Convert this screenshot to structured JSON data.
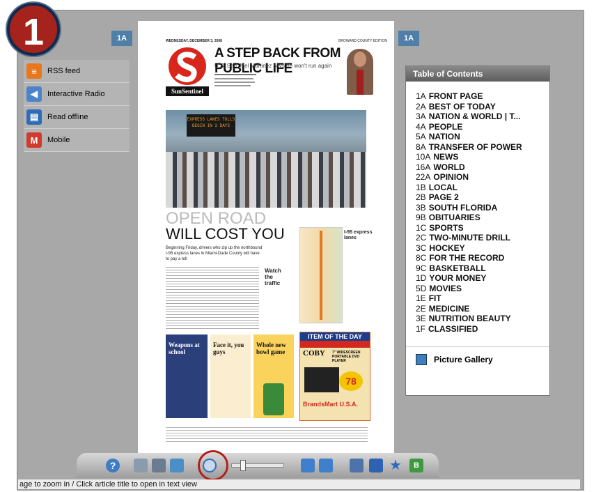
{
  "step_badge": "1",
  "page_tags": {
    "left": "1A",
    "right": "1A"
  },
  "left_panel": {
    "items": [
      {
        "label": "RSS feed",
        "icon": "rss-icon",
        "color": "#e8781a"
      },
      {
        "label": "Interactive Radio",
        "icon": "speaker-icon",
        "color": "#4b84c9"
      },
      {
        "label": "Read offline",
        "icon": "save-disk-icon",
        "color": "#2f6cb8"
      },
      {
        "label": "Mobile",
        "icon": "gmail-icon",
        "color": "#d23b2c"
      }
    ]
  },
  "newspaper": {
    "dateline": "WEDNESDAY, DECEMBER 3, 2008",
    "edition": "BROWARD COUNTY EDITION",
    "brand": "SunSentinel",
    "headline": "A STEP BACK FROM PUBLIC LIFE",
    "subhead": "U.S. Sen. Mel Martinez says he won't run again",
    "road_sign": "EXPRESS LANES TOLLS BEGIN IN 3 DAYS",
    "main_head_1": "OPEN ROAD",
    "main_head_2": "WILL COST YOU",
    "deck": "Beginning Friday, drivers who zip up the northbound I-95 express lanes in Miami-Dade County will have to pay a toll",
    "sidebar_head": "Watch the traffic",
    "map_head": "I-95 express lanes",
    "promo_1_head": "Weapons at school",
    "promo_2_head": "Face it, you guys",
    "promo_3_head": "Whole new bowl game",
    "ad_head": "ITEM OF THE DAY",
    "ad_brand": "COBY",
    "ad_desc": "7\" WIDESCREEN PORTABLE DVD PLAYER",
    "ad_price": "78",
    "ad_store": "BrandsMart U.S.A."
  },
  "toc": {
    "title": "Table of Contents",
    "items": [
      {
        "page": "1A",
        "label": "FRONT PAGE"
      },
      {
        "page": "2A",
        "label": "BEST OF TODAY"
      },
      {
        "page": "3A",
        "label": "NATION & WORLD | T..."
      },
      {
        "page": "4A",
        "label": "PEOPLE"
      },
      {
        "page": "5A",
        "label": "NATION"
      },
      {
        "page": "8A",
        "label": "TRANSFER OF POWER"
      },
      {
        "page": "10A",
        "label": "NEWS"
      },
      {
        "page": "16A",
        "label": "WORLD"
      },
      {
        "page": "22A",
        "label": "OPINION"
      },
      {
        "page": "1B",
        "label": "LOCAL"
      },
      {
        "page": "2B",
        "label": "PAGE 2"
      },
      {
        "page": "3B",
        "label": "SOUTH FLORIDA"
      },
      {
        "page": "9B",
        "label": "OBITUARIES"
      },
      {
        "page": "1C",
        "label": "SPORTS"
      },
      {
        "page": "2C",
        "label": "TWO-MINUTE DRILL"
      },
      {
        "page": "3C",
        "label": "HOCKEY"
      },
      {
        "page": "8C",
        "label": "FOR THE RECORD"
      },
      {
        "page": "9C",
        "label": "BASKETBALL"
      },
      {
        "page": "1D",
        "label": "YOUR MONEY"
      },
      {
        "page": "5D",
        "label": "MOVIES"
      },
      {
        "page": "1E",
        "label": "FIT"
      },
      {
        "page": "2E",
        "label": "MEDICINE"
      },
      {
        "page": "3E",
        "label": "NUTRITION BEAUTY"
      },
      {
        "page": "1F",
        "label": "CLASSIFIED"
      }
    ],
    "gallery_label": "Picture Gallery"
  },
  "toolbar": {
    "buttons": [
      {
        "name": "help-icon",
        "color": "#3e7cc4"
      },
      {
        "name": "print-page-icon",
        "color": "#8a9bb0"
      },
      {
        "name": "copy-pages-icon",
        "color": "#6b7c90"
      },
      {
        "name": "image-view-icon",
        "color": "#4a8fc8"
      },
      {
        "name": "zoom-in-icon",
        "color": "#3e9f3e"
      },
      {
        "name": "previous-page-icon",
        "color": "#3f7fcc"
      },
      {
        "name": "next-page-icon",
        "color": "#3f7fcc"
      },
      {
        "name": "print-icon",
        "color": "#4e73a8"
      },
      {
        "name": "save-icon",
        "color": "#2f62b0"
      },
      {
        "name": "favorite-add-icon",
        "color": "#3a6fc0"
      },
      {
        "name": "export-icon",
        "color": "#3f9a3f"
      }
    ],
    "zoom_level_percent": 0
  },
  "status_text": "age to zoom in / Click article title to open in text view"
}
